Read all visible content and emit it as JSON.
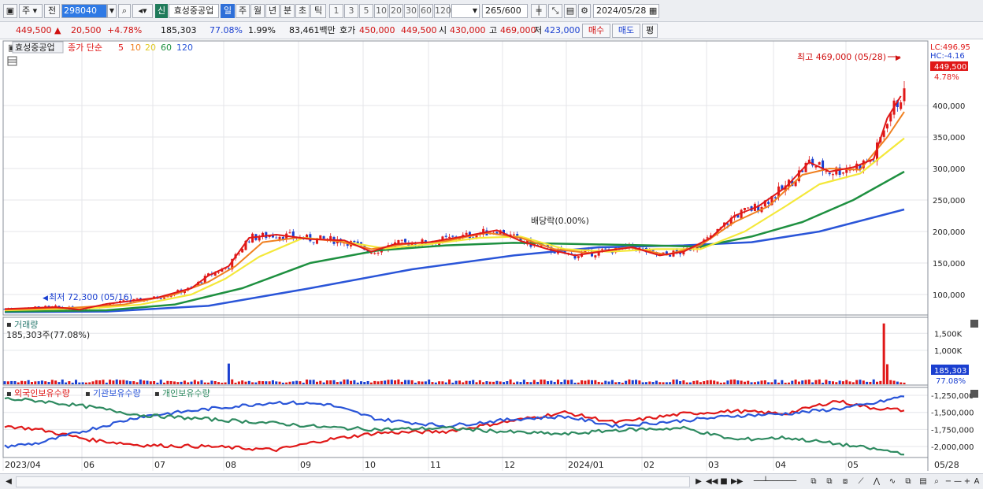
{
  "toolbar": {
    "market": "주",
    "prev": "전",
    "code": "298040",
    "name_badge": "신",
    "name": "효성중공업",
    "periods": [
      "일",
      "주",
      "월",
      "년",
      "분",
      "초",
      "틱"
    ],
    "numbers": [
      "1",
      "3",
      "5",
      "10",
      "20",
      "30",
      "60",
      "120"
    ],
    "count": "265",
    "count_total": "/600",
    "date": "2024/05/28"
  },
  "quote": {
    "price": "449,500",
    "change": "20,500",
    "change_pct": "+4.78%",
    "volume": "185,303",
    "vol_pct": "77.08%",
    "turnover_pct": "1.99%",
    "amount": "83,461백만",
    "ask_label": "호가",
    "ask1": "450,000",
    "ask2": "449,500",
    "open_label": "시",
    "open": "430,000",
    "high_label": "고",
    "high": "469,000",
    "low_label": "저",
    "low": "423,000",
    "buy": "매수",
    "sell": "매도",
    "eval": "평"
  },
  "colors": {
    "ma5": "#e01818",
    "ma10": "#f08020",
    "ma20": "#f4e83a",
    "ma60": "#1e9040",
    "ma120": "#2a55d8",
    "up": "#e01818",
    "down": "#1a3fd0",
    "foreign": "#e01818",
    "inst": "#2a55d8",
    "retail": "#2e8a60"
  },
  "price_panel": {
    "title": "효성중공업",
    "ma_label": "종가 단순",
    "ma_periods": [
      "5",
      "10",
      "20",
      "60",
      "120"
    ],
    "lc": "LC:496.95",
    "hc": "HC:-4.16",
    "last_price": "449,500",
    "last_pct": "4.78%",
    "high_note": "최고 469,000 (05/28)",
    "low_note": "최저 72,300 (05/16)",
    "dividend_note": "배당락(0.00%)"
  },
  "volume_panel": {
    "title": "거래량",
    "value": "185,303주(77.08%)",
    "last": "185,303",
    "last_pct": "77.08%"
  },
  "holdings_panel": {
    "legend": [
      "외국인보유수량",
      "기관보유수량",
      "개인보유수량"
    ]
  },
  "chart_data": [
    {
      "type": "candlestick",
      "title": "효성중공업",
      "y_ticks": [
        "400,000",
        "350,000",
        "300,000",
        "250,000",
        "200,000",
        "150,000",
        "100,000"
      ],
      "ylim": [
        70000,
        500000
      ],
      "x_labels": [
        "2023/04",
        "06",
        "07",
        "08",
        "09",
        "10",
        "11",
        "12",
        "2024/01",
        "02",
        "03",
        "04",
        "05",
        "05/28"
      ],
      "series": [
        {
          "name": "5",
          "points": [
            [
              0,
              77000
            ],
            [
              15,
              80000
            ],
            [
              22,
              76000
            ],
            [
              30,
              85000
            ],
            [
              45,
              95000
            ],
            [
              55,
              110000
            ],
            [
              60,
              130000
            ],
            [
              66,
              145000
            ],
            [
              72,
              190000
            ],
            [
              80,
              195000
            ],
            [
              90,
              188000
            ],
            [
              100,
              186000
            ],
            [
              108,
              168000
            ],
            [
              115,
              180000
            ],
            [
              125,
              183000
            ],
            [
              135,
              192000
            ],
            [
              145,
              202000
            ],
            [
              152,
              185000
            ],
            [
              160,
              172000
            ],
            [
              168,
              162000
            ],
            [
              178,
              170000
            ],
            [
              185,
              175000
            ],
            [
              193,
              162000
            ],
            [
              200,
              168000
            ],
            [
              208,
              190000
            ],
            [
              215,
              225000
            ],
            [
              222,
              240000
            ],
            [
              230,
              270000
            ],
            [
              237,
              310000
            ],
            [
              243,
              295000
            ],
            [
              250,
              302000
            ],
            [
              256,
              315000
            ],
            [
              260,
              380000
            ],
            [
              264,
              415000
            ]
          ]
        },
        {
          "name": "10",
          "points": [
            [
              0,
              76000
            ],
            [
              20,
              79000
            ],
            [
              35,
              84000
            ],
            [
              50,
              100000
            ],
            [
              60,
              120000
            ],
            [
              68,
              145000
            ],
            [
              76,
              183000
            ],
            [
              86,
              190000
            ],
            [
              98,
              185000
            ],
            [
              108,
              172000
            ],
            [
              118,
              180000
            ],
            [
              130,
              185000
            ],
            [
              142,
              198000
            ],
            [
              152,
              190000
            ],
            [
              162,
              172000
            ],
            [
              172,
              166000
            ],
            [
              184,
              175000
            ],
            [
              195,
              163000
            ],
            [
              205,
              178000
            ],
            [
              215,
              215000
            ],
            [
              225,
              240000
            ],
            [
              235,
              290000
            ],
            [
              243,
              300000
            ],
            [
              252,
              298000
            ],
            [
              260,
              350000
            ],
            [
              265,
              390000
            ]
          ]
        },
        {
          "name": "20",
          "points": [
            [
              0,
              75000
            ],
            [
              25,
              78000
            ],
            [
              40,
              84000
            ],
            [
              55,
              100000
            ],
            [
              65,
              125000
            ],
            [
              75,
              160000
            ],
            [
              88,
              190000
            ],
            [
              100,
              184000
            ],
            [
              112,
              173000
            ],
            [
              125,
              180000
            ],
            [
              140,
              190000
            ],
            [
              152,
              192000
            ],
            [
              165,
              172000
            ],
            [
              178,
              168000
            ],
            [
              192,
              172000
            ],
            [
              205,
              172000
            ],
            [
              218,
              200000
            ],
            [
              230,
              240000
            ],
            [
              240,
              275000
            ],
            [
              252,
              292000
            ],
            [
              265,
              348000
            ]
          ]
        },
        {
          "name": "60",
          "points": [
            [
              0,
              73000
            ],
            [
              30,
              75000
            ],
            [
              50,
              84000
            ],
            [
              70,
              110000
            ],
            [
              90,
              150000
            ],
            [
              110,
              170000
            ],
            [
              130,
              178000
            ],
            [
              150,
              182000
            ],
            [
              170,
              180000
            ],
            [
              190,
              178000
            ],
            [
              205,
              176000
            ],
            [
              220,
              192000
            ],
            [
              235,
              215000
            ],
            [
              250,
              250000
            ],
            [
              265,
              295000
            ]
          ]
        },
        {
          "name": "120",
          "points": [
            [
              0,
              72000
            ],
            [
              30,
              73000
            ],
            [
              60,
              82000
            ],
            [
              90,
              110000
            ],
            [
              120,
              140000
            ],
            [
              150,
              162000
            ],
            [
              175,
              175000
            ],
            [
              200,
              178000
            ],
            [
              220,
              183000
            ],
            [
              240,
              200000
            ],
            [
              265,
              235000
            ]
          ]
        }
      ]
    },
    {
      "type": "bar",
      "title": "거래량",
      "y_ticks": [
        "1,500K",
        "1,000K"
      ],
      "ylim": [
        0,
        1900000
      ],
      "spikes": [
        [
          66,
          610000
        ],
        [
          259,
          1790000
        ],
        [
          260,
          590000
        ]
      ],
      "base_level": 90000
    },
    {
      "type": "line",
      "y_ticks": [
        "-1,250,000",
        "-1,500,000",
        "-1,750,000",
        "-2,000,000"
      ],
      "ylim": [
        -2150000,
        -1180000
      ],
      "series": [
        {
          "name": "외국인보유수량",
          "points": [
            [
              0,
              -1700000
            ],
            [
              10,
              -1750000
            ],
            [
              25,
              -1900000
            ],
            [
              40,
              -1980000
            ],
            [
              60,
              -2000000
            ],
            [
              80,
              -2050000
            ],
            [
              95,
              -1900000
            ],
            [
              110,
              -1800000
            ],
            [
              130,
              -1780000
            ],
            [
              150,
              -1620000
            ],
            [
              165,
              -1500000
            ],
            [
              180,
              -1650000
            ],
            [
              200,
              -1520000
            ],
            [
              215,
              -1480000
            ],
            [
              230,
              -1520000
            ],
            [
              245,
              -1330000
            ],
            [
              255,
              -1430000
            ],
            [
              265,
              -1470000
            ]
          ]
        },
        {
          "name": "기관보유수량",
          "points": [
            [
              0,
              -2000000
            ],
            [
              10,
              -1950000
            ],
            [
              25,
              -1750000
            ],
            [
              40,
              -1560000
            ],
            [
              60,
              -1450000
            ],
            [
              80,
              -1350000
            ],
            [
              95,
              -1380000
            ],
            [
              110,
              -1600000
            ],
            [
              130,
              -1700000
            ],
            [
              150,
              -1600000
            ],
            [
              165,
              -1560000
            ],
            [
              180,
              -1700000
            ],
            [
              200,
              -1620000
            ],
            [
              215,
              -1550000
            ],
            [
              230,
              -1520000
            ],
            [
              245,
              -1450000
            ],
            [
              255,
              -1380000
            ],
            [
              265,
              -1260000
            ]
          ]
        },
        {
          "name": "개인보유수량",
          "points": [
            [
              0,
              -1300000
            ],
            [
              10,
              -1330000
            ],
            [
              25,
              -1420000
            ],
            [
              40,
              -1540000
            ],
            [
              60,
              -1600000
            ],
            [
              80,
              -1660000
            ],
            [
              95,
              -1720000
            ],
            [
              110,
              -1750000
            ],
            [
              130,
              -1730000
            ],
            [
              150,
              -1790000
            ],
            [
              165,
              -1820000
            ],
            [
              180,
              -1760000
            ],
            [
              200,
              -1730000
            ],
            [
              215,
              -1900000
            ],
            [
              230,
              -1870000
            ],
            [
              245,
              -1960000
            ],
            [
              255,
              -2030000
            ],
            [
              265,
              -2100000
            ]
          ]
        }
      ]
    }
  ]
}
